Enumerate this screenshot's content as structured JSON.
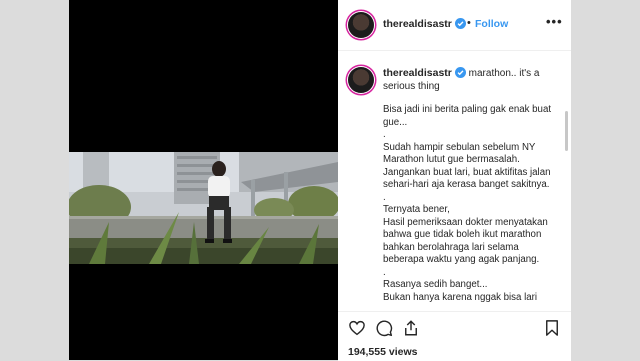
{
  "post": {
    "username": "therealdisastr",
    "follow_label": "Follow",
    "separator": "•",
    "more_label": "•••",
    "caption_head": "marathon.. it's a serious thing",
    "caption_body": "Bisa jadi ini berita paling gak enak buat gue...\n.\nSudah hampir sebulan sebelum NY Marathon lutut gue bermasalah. Jangankan buat lari, buat aktifitas jalan sehari-hari aja kerasa banget sakitnya.\n.\nTernyata bener,\nHasil pemeriksaan dokter menyatakan bahwa gue tidak boleh ikut marathon bahkan berolahraga lari selama beberapa waktu yang agak panjang.\n.\nRasanya sedih banget...\nBukan hanya karena nggak bisa lari",
    "views": "194,555 views"
  },
  "icons": {
    "verified": "verified-badge-icon",
    "like": "heart-icon",
    "comment": "comment-icon",
    "share": "share-icon",
    "save": "bookmark-icon"
  },
  "colors": {
    "link": "#3897f0",
    "verified": "#3897f0",
    "text": "#262626",
    "backdrop": "#dcdcdc",
    "media_bg": "#000000"
  }
}
